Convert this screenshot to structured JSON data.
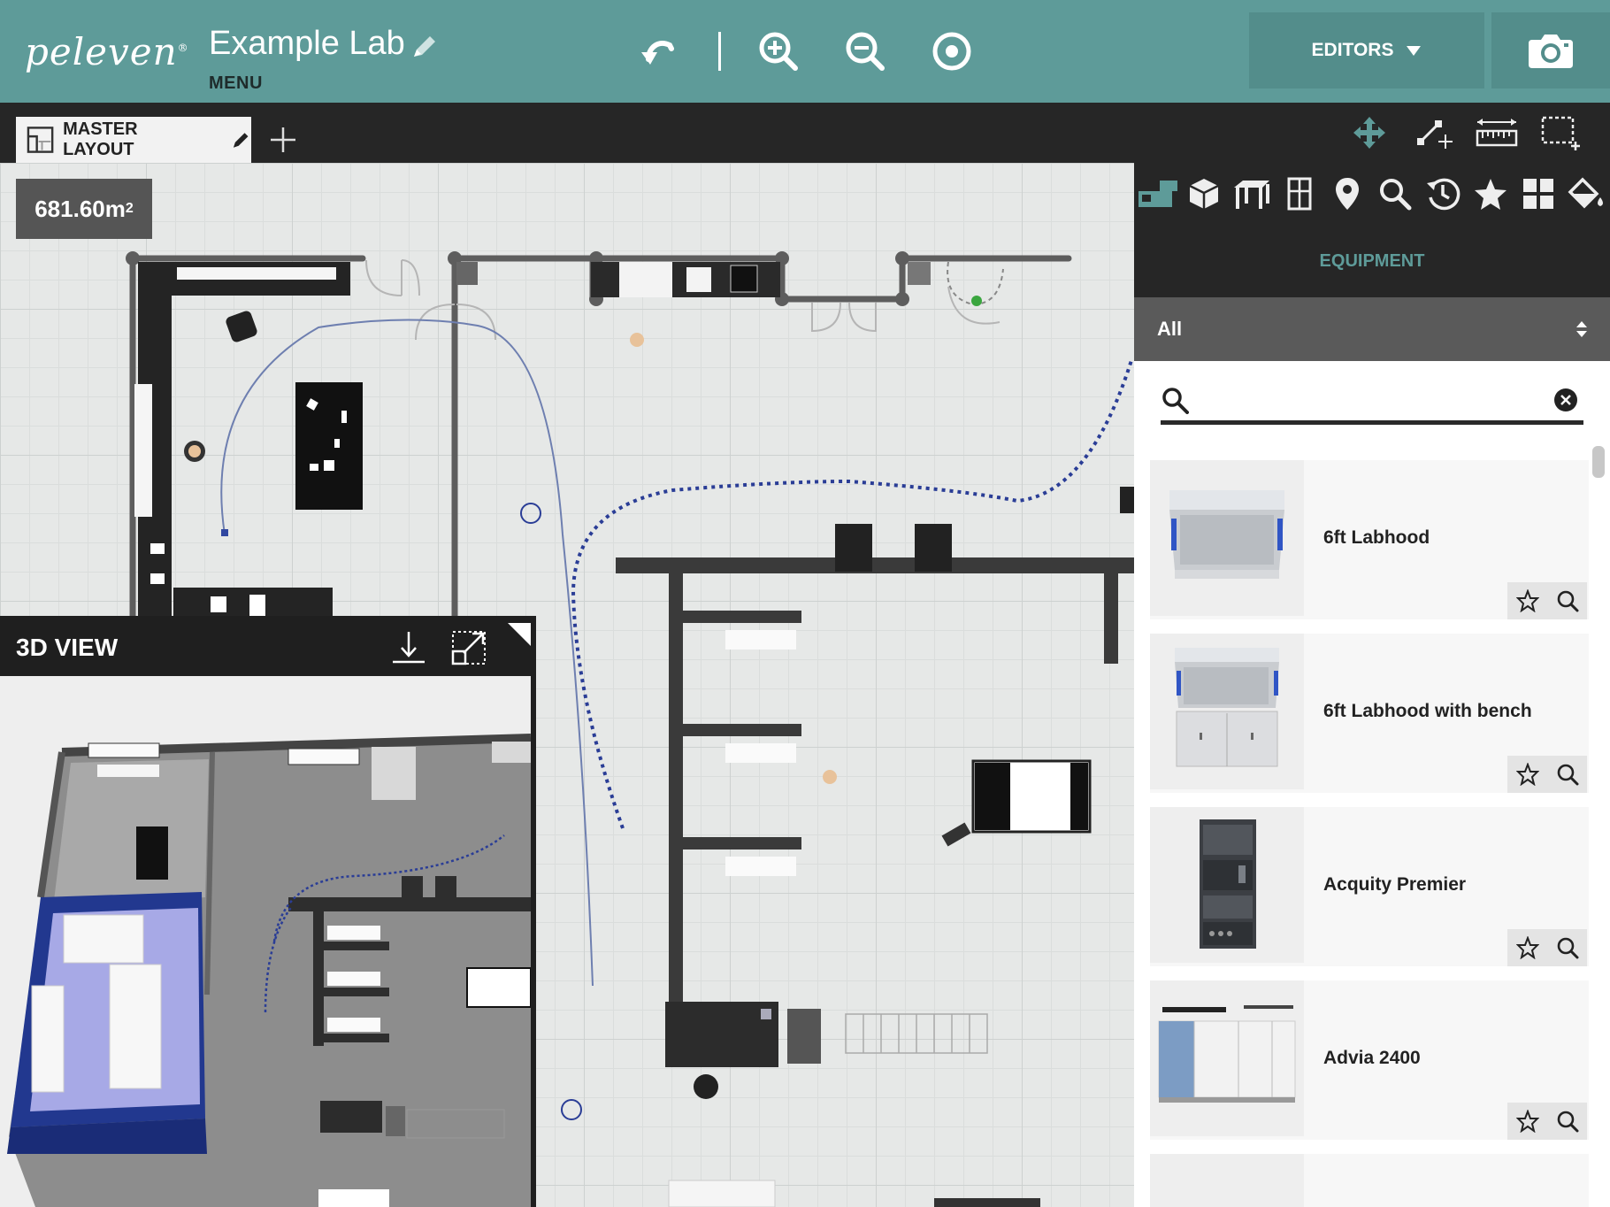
{
  "header": {
    "logo": "peleven",
    "logo_mark": "®",
    "project_title": "Example Lab",
    "menu_label": "MENU",
    "editors_label": "EDITORS",
    "accent_color": "#5e9b99"
  },
  "tabs": {
    "master_layout_label": "MASTER LAYOUT"
  },
  "canvas": {
    "area_value": "681.60m",
    "area_unit_power": "2"
  },
  "view3d": {
    "title": "3D VIEW"
  },
  "panel": {
    "category_title": "EQUIPMENT",
    "filter_value": "All",
    "search_value": "",
    "category_icons": [
      "equipment-icon",
      "cube-icon",
      "furniture-icon",
      "window-icon",
      "location-pin-icon",
      "search-icon",
      "history-icon",
      "star-icon",
      "grid-icon",
      "paint-bucket-icon"
    ],
    "equipment": [
      {
        "name": "6ft Labhood"
      },
      {
        "name": "6ft Labhood with bench"
      },
      {
        "name": "Acquity Premier"
      },
      {
        "name": "Advia 2400"
      }
    ]
  }
}
